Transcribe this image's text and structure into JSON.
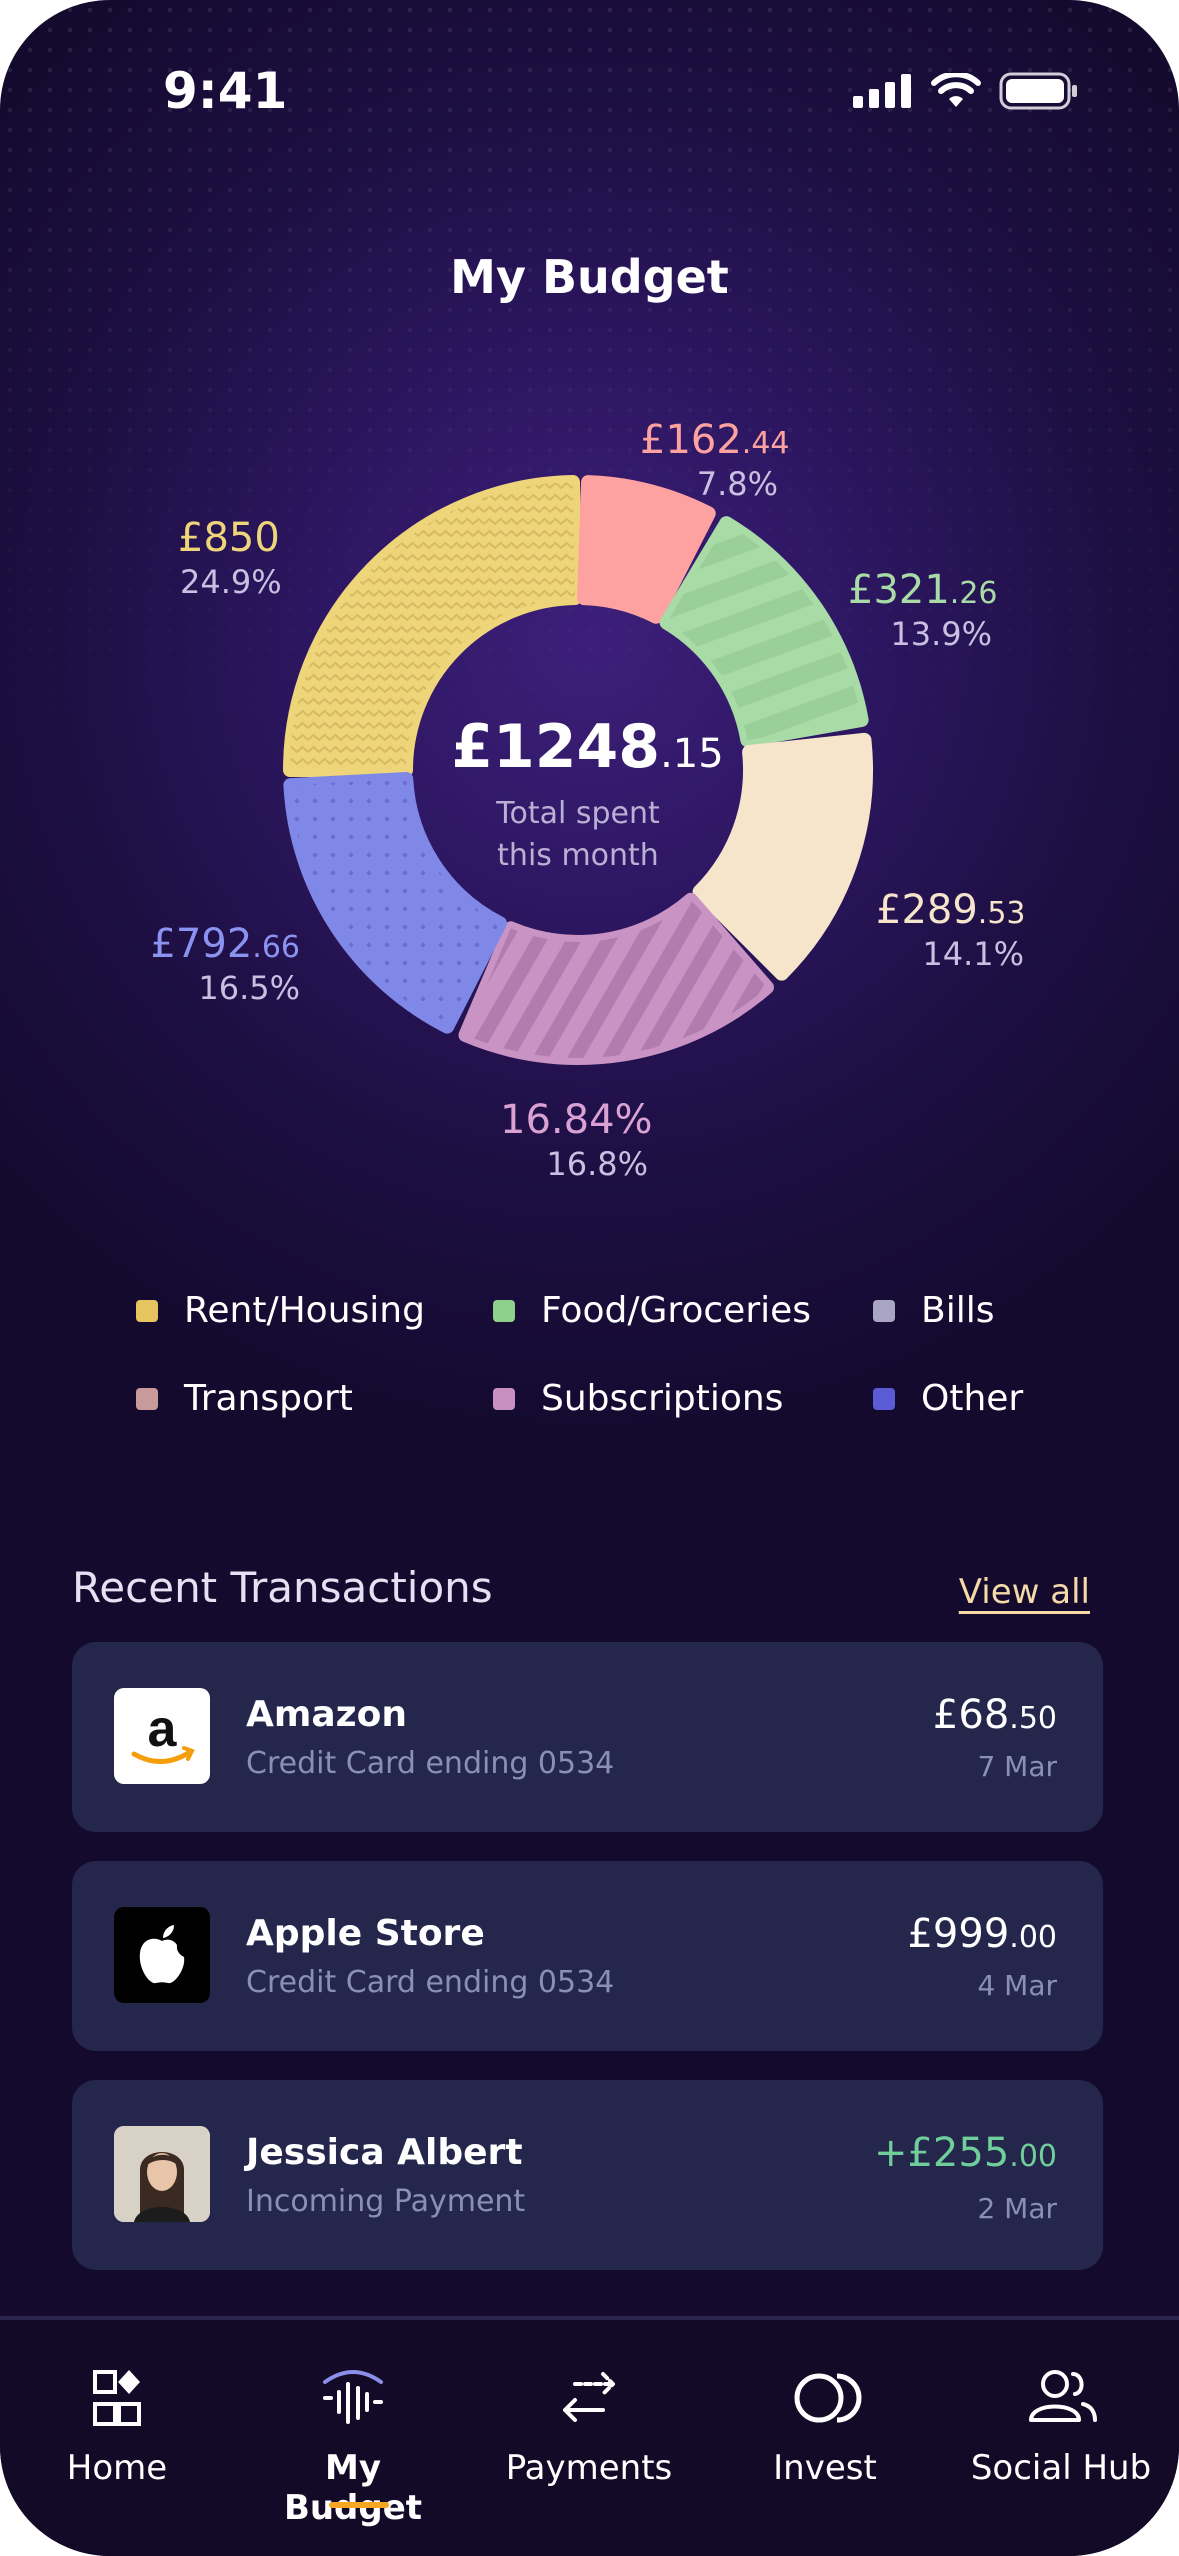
{
  "status_bar": {
    "time": "9:41"
  },
  "page_title": "My Budget",
  "chart_data": {
    "type": "pie",
    "total": {
      "main": "£1248",
      "decimals": ".15",
      "caption_line1": "Total spent",
      "caption_line2": "this month"
    },
    "slices": [
      {
        "category": "Rent/Housing",
        "amount_main": "£850",
        "amount_dec": "",
        "percent_label": "24.9%",
        "value": 850,
        "color": "#efd57a"
      },
      {
        "category": "Transport",
        "amount_main": "£162",
        "amount_dec": ".44",
        "percent_label": "7.8%",
        "value": 162.44,
        "color": "#fda2a0"
      },
      {
        "category": "Food/Groceries",
        "amount_main": "£321",
        "amount_dec": ".26",
        "percent_label": "13.9%",
        "value": 321.26,
        "color": "#a9dba6"
      },
      {
        "category": "Bills",
        "amount_main": "£289",
        "amount_dec": ".53",
        "percent_label": "14.1%",
        "value": 289.53,
        "color": "#f6e5cb"
      },
      {
        "category": "Subscriptions",
        "amount_main": "16.84%",
        "amount_dec": "",
        "percent_label": "16.8%",
        "value": 16.84,
        "color": "#c994c4"
      },
      {
        "category": "Other",
        "amount_main": "£792",
        "amount_dec": ".66",
        "percent_label": "16.5%",
        "value": 792.66,
        "color": "#7f88e6"
      }
    ],
    "legend": [
      {
        "label": "Rent/Housing",
        "color": "#e6c45e"
      },
      {
        "label": "Food/Groceries",
        "color": "#8fcf8c"
      },
      {
        "label": "Bills",
        "color": "#a9a6c4"
      },
      {
        "label": "Transport",
        "color": "#c99a9a"
      },
      {
        "label": "Subscriptions",
        "color": "#c88fc0"
      },
      {
        "label": "Other",
        "color": "#5b5bd6"
      }
    ]
  },
  "transactions": {
    "title": "Recent Transactions",
    "view_all": "View all",
    "items": [
      {
        "name": "Amazon",
        "sub": "Credit Card ending 0534",
        "amount_main": "£68",
        "amount_dec": ".50",
        "date": "7 Mar",
        "logo": "amazon-logo"
      },
      {
        "name": "Apple Store",
        "sub": "Credit Card ending 0534",
        "amount_main": "£999",
        "amount_dec": ".00",
        "date": "4 Mar",
        "logo": "apple-logo"
      },
      {
        "name": "Jessica Albert",
        "sub": "Incoming Payment",
        "amount_main": "+£255",
        "amount_dec": ".00",
        "date": "2 Mar",
        "logo": "avatar"
      }
    ]
  },
  "nav": {
    "items": [
      {
        "label": "Home",
        "icon": "home-grid-icon"
      },
      {
        "label": "My Budget",
        "icon": "budget-waveform-icon",
        "active": true
      },
      {
        "label": "Payments",
        "icon": "transfer-arrows-icon"
      },
      {
        "label": "Invest",
        "icon": "invest-circles-icon"
      },
      {
        "label": "Social Hub",
        "icon": "people-icon"
      }
    ]
  }
}
